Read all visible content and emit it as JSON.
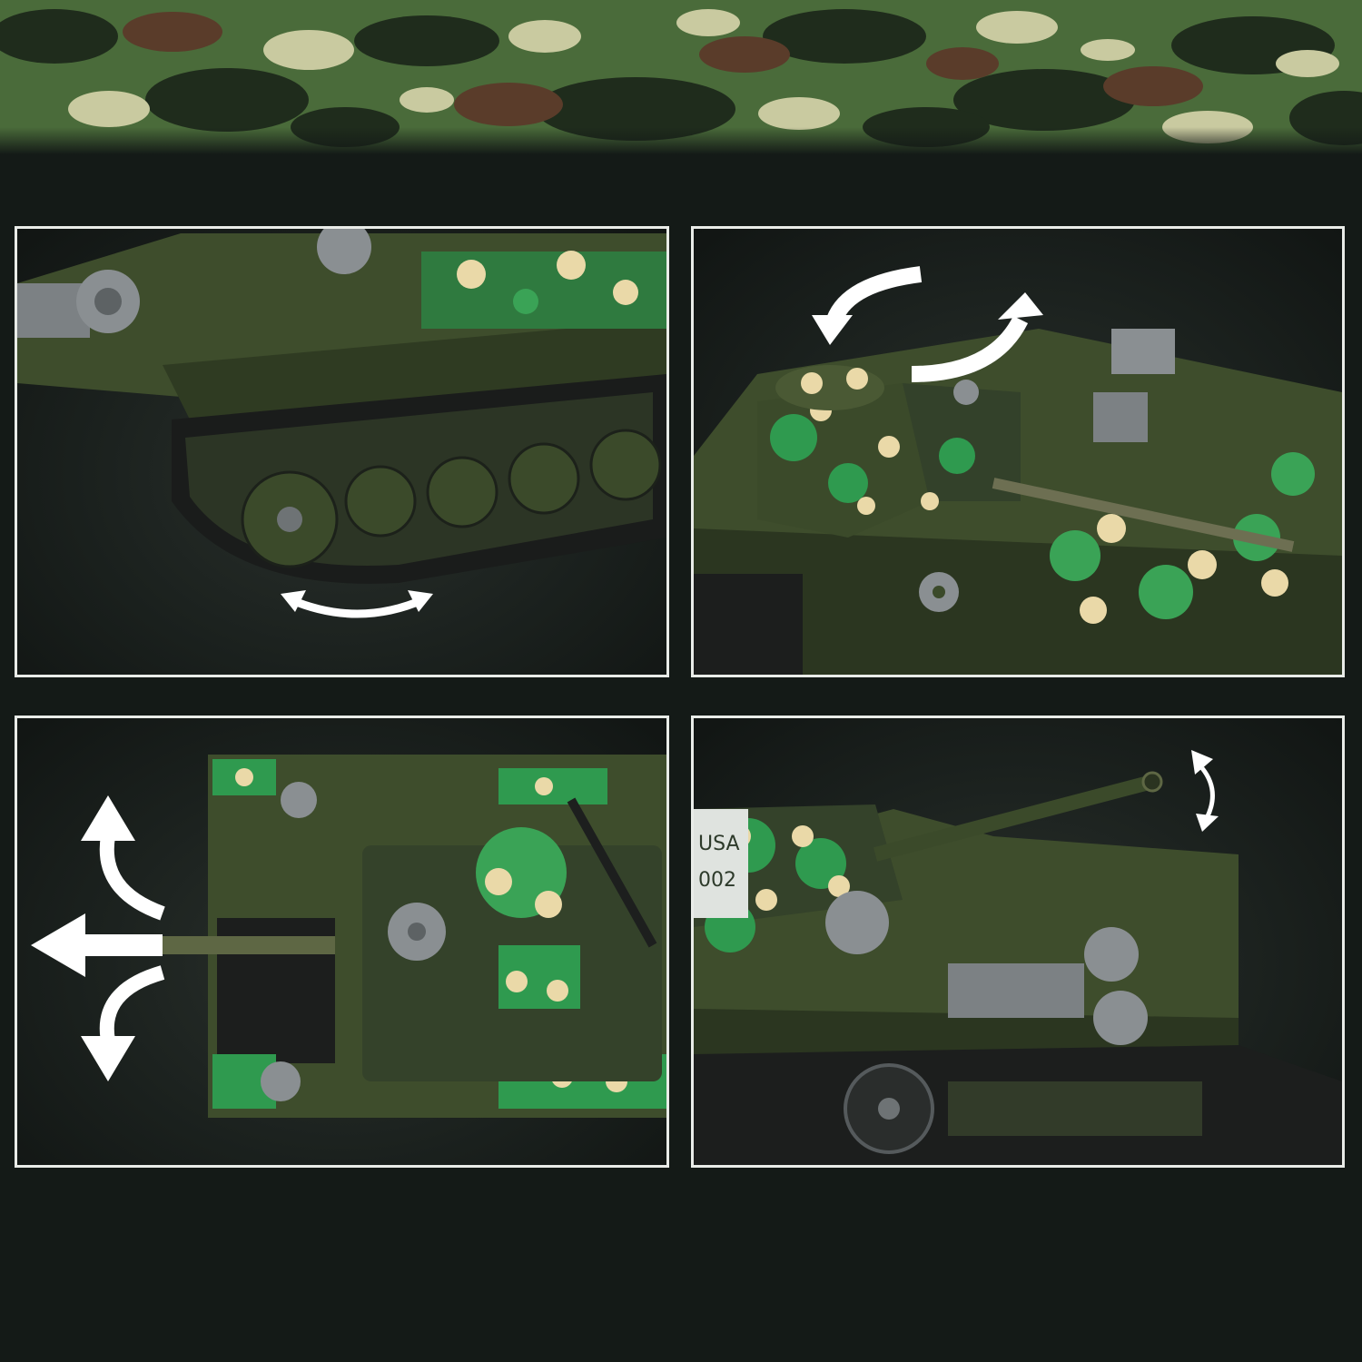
{
  "colors": {
    "background": "#141a17",
    "panel_border": "#e9ece8",
    "tank_olive": "#3e4d2c",
    "tank_dark": "#2b3620",
    "camo_green": "#3aa356",
    "camo_tan": "#ead9a8",
    "metal_gray": "#808587",
    "arrow_white": "#ffffff"
  },
  "banner": {
    "pattern": "woodland-camouflage"
  },
  "panels": [
    {
      "view": "track-suspension-closeup",
      "arrow": "double-arrow-horizontal-icon"
    },
    {
      "view": "rotating-turret",
      "arrow": "rotate-arrows-icon"
    },
    {
      "view": "top-down-gun-traverse",
      "arrow": "three-direction-arrows-icon"
    },
    {
      "view": "gun-elevation-side",
      "arrow": "curved-double-arrow-icon"
    }
  ],
  "hull_marking": {
    "line1": "USA",
    "line2": "002"
  }
}
